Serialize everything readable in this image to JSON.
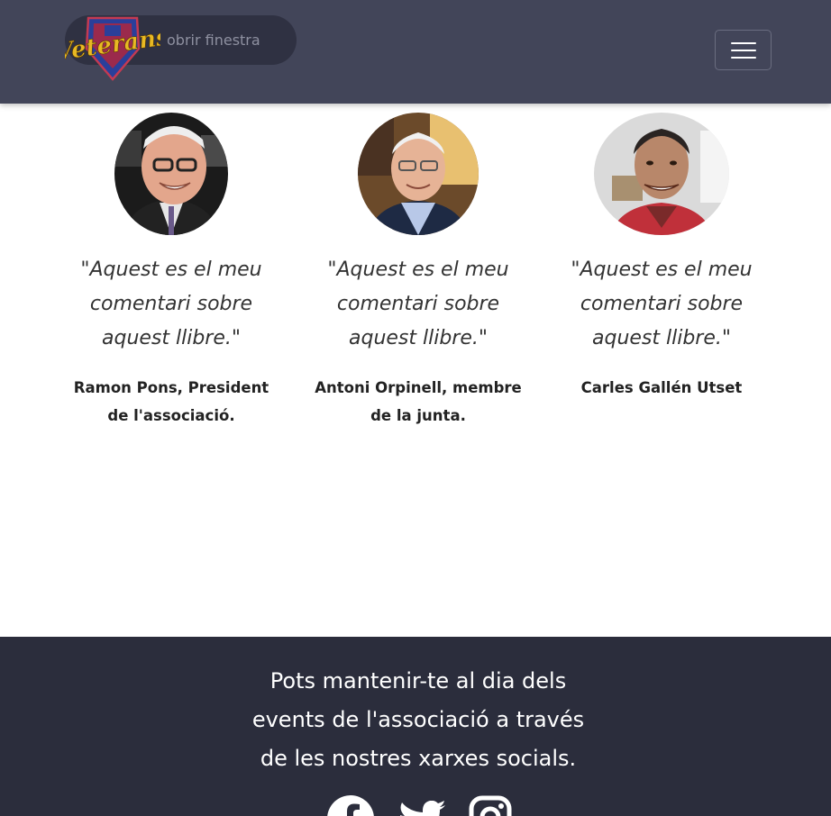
{
  "header": {
    "open_window_label": "obrir finestra",
    "logo_text": "Veterans",
    "logo_alt": "Veterans logo",
    "menu_icon": "hamburger-menu-icon",
    "colors": {
      "navbar_bg": "#424559",
      "logo_text": "#e8b923",
      "logo_shield": "#2a3f9a"
    }
  },
  "testimonials": [
    {
      "quote": "\"Aquest es el meu comentari sobre aquest llibre.\"",
      "author": "Ramon Pons, President de l'associació."
    },
    {
      "quote": "\"Aquest es el meu comentari sobre aquest llibre.\"",
      "author": "Antoni Orpinell, membre de la junta."
    },
    {
      "quote": "\"Aquest es el meu comentari sobre aquest llibre.\"",
      "author": "Carles Gallén Utset"
    }
  ],
  "footer": {
    "text": "Pots mantenir-te al dia dels events de l'associació a través de les nostres xarxes socials.",
    "socials": [
      "facebook-icon",
      "twitter-icon",
      "instagram-icon"
    ],
    "colors": {
      "footer_bg": "#2b2d3c",
      "text": "#ffffff"
    }
  }
}
